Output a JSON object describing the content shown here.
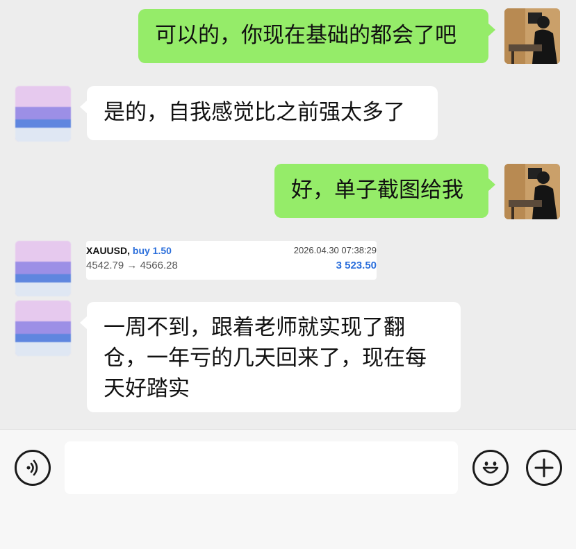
{
  "messages": [
    {
      "sender": "self",
      "text": "可以的，你现在基础的都会了吧"
    },
    {
      "sender": "other",
      "text": "是的，自我感觉比之前强太多了"
    },
    {
      "sender": "self",
      "text": "好，单子截图给我"
    },
    {
      "sender": "other",
      "type": "trade_card",
      "trade": {
        "symbol": "XAUUSD,",
        "side": "buy 1.50",
        "time": "2026.04.30 07:38:29",
        "open_price": "4542.79",
        "arrow": "→",
        "close_price": "4566.28",
        "profit": "3 523.50"
      }
    },
    {
      "sender": "other",
      "lines": [
        "一周不到，跟着老师就实现了翻",
        "仓，一年亏的几天回来了，现在每",
        "天好踏实"
      ]
    }
  ],
  "input": {
    "value": "",
    "placeholder": ""
  },
  "icons": {
    "voice": "voice-icon",
    "emoji": "emoji-icon",
    "plus": "plus-icon"
  },
  "colors": {
    "self_bubble": "#95ec69",
    "other_bubble": "#ffffff",
    "background": "#ededed",
    "trade_blue": "#2a6edb"
  }
}
